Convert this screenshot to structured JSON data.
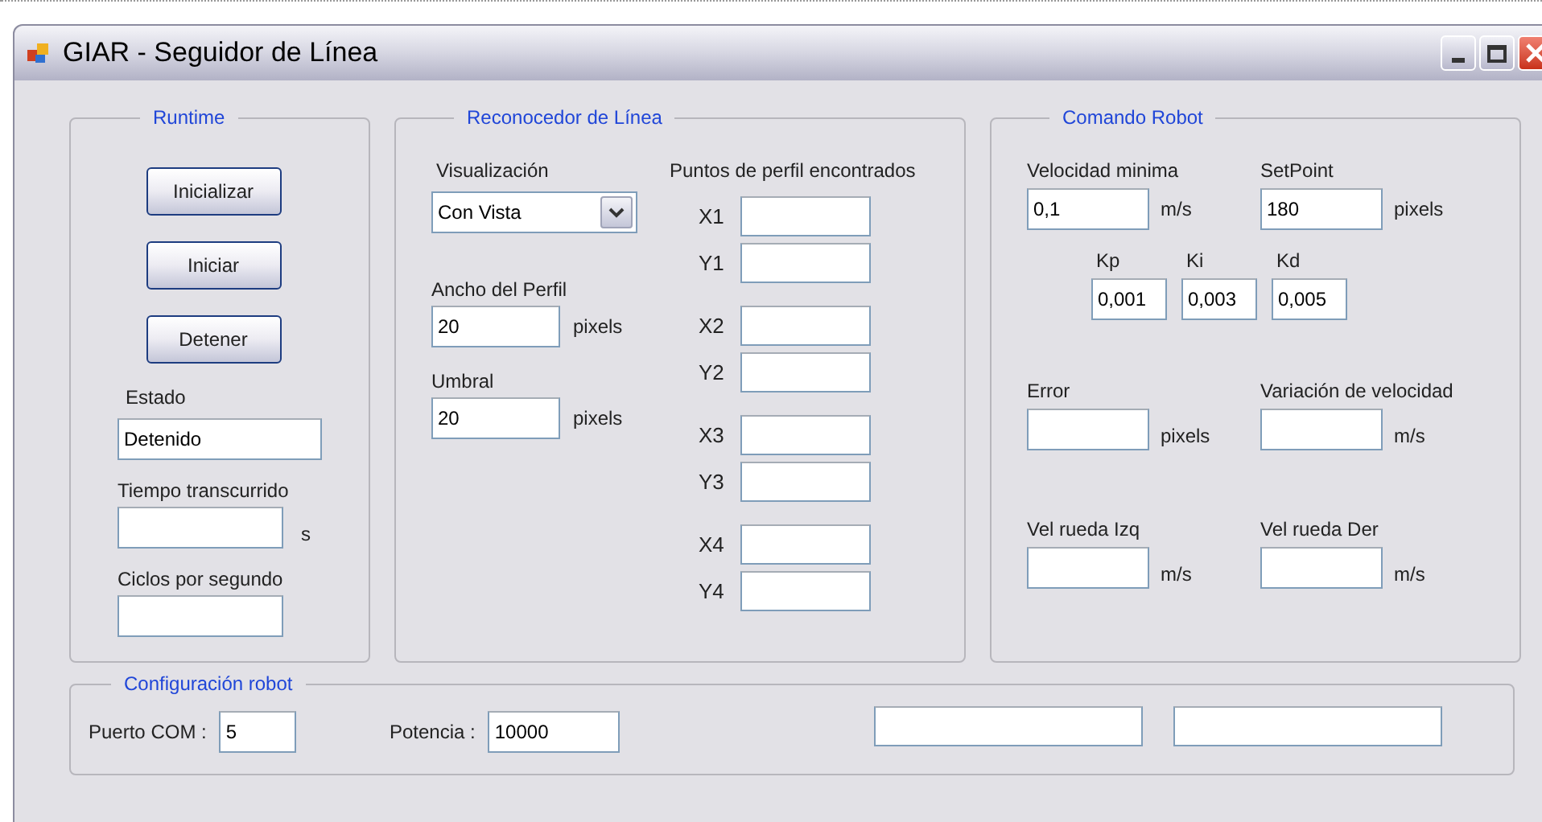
{
  "window": {
    "title": "GIAR - Seguidor de Línea"
  },
  "runtime": {
    "title": "Runtime",
    "buttons": [
      "Inicializar",
      "Iniciar",
      "Detener"
    ],
    "fields": [
      {
        "label": "Estado",
        "value": "Detenido"
      },
      {
        "label": "Tiempo transcurrido",
        "unit": "s"
      },
      {
        "label": "Ciclos por segundo"
      }
    ]
  },
  "recognizer": {
    "title": "Reconocedor de Línea",
    "visualization": {
      "label": "Visualización",
      "value": "Con Vista"
    },
    "fields": [
      {
        "label": "Ancho del Perfil",
        "value": "20",
        "unit": "pixels"
      },
      {
        "label": "Umbral",
        "value": "20",
        "unit": "pixels"
      }
    ],
    "points": {
      "title": "Puntos de perfil encontrados",
      "pairs": [
        [
          "X1",
          "Y1"
        ],
        [
          "X2",
          "Y2"
        ],
        [
          "X3",
          "Y3"
        ],
        [
          "X4",
          "Y4"
        ]
      ]
    }
  },
  "command": {
    "title": "Comando Robot",
    "rows": [
      [
        {
          "label": "Velocidad minima",
          "value": "0,1",
          "unit": "m/s"
        },
        {
          "label": "SetPoint",
          "value": "180",
          "unit": "pixels"
        }
      ]
    ],
    "gains": [
      {
        "label": "Kp",
        "value": "0,001"
      },
      {
        "label": "Ki",
        "value": "0,003"
      },
      {
        "label": "Kd",
        "value": "0,005"
      }
    ],
    "outputs": [
      [
        {
          "label": "Error",
          "unit": "pixels"
        },
        {
          "label": "Variación de velocidad",
          "unit": "m/s"
        }
      ],
      [
        {
          "label": "Vel rueda Izq",
          "unit": "m/s"
        },
        {
          "label": "Vel rueda Der",
          "unit": "m/s"
        }
      ]
    ]
  },
  "config": {
    "title": "Configuración robot",
    "fields": [
      {
        "label": "Puerto COM :",
        "value": "5"
      },
      {
        "label": "Potencia :",
        "value": "10000"
      }
    ]
  }
}
